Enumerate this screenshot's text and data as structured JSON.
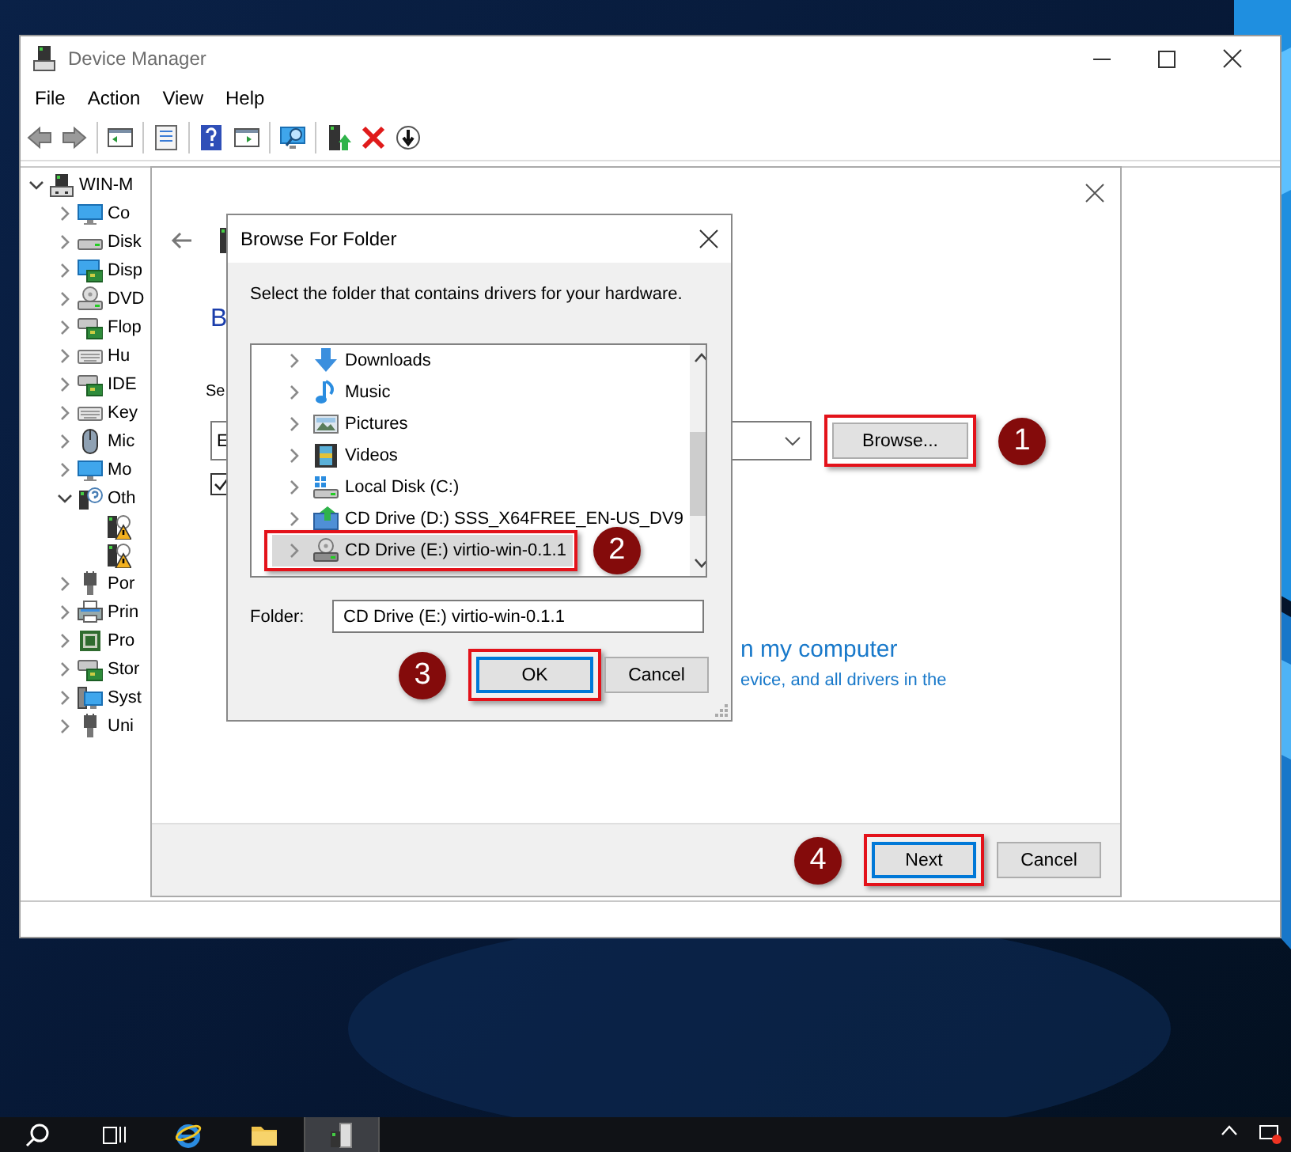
{
  "device_manager": {
    "title": "Device Manager",
    "menu": [
      "File",
      "Action",
      "View",
      "Help"
    ],
    "tree": {
      "label": "WIN-M",
      "expanded": true,
      "children": [
        {
          "label": "Co",
          "expanded": false
        },
        {
          "label": "Disk",
          "expanded": false
        },
        {
          "label": "Disp",
          "expanded": false
        },
        {
          "label": "DVD",
          "expanded": false
        },
        {
          "label": "Flop",
          "expanded": false
        },
        {
          "label": "Hu",
          "expanded": false
        },
        {
          "label": "IDE",
          "expanded": false
        },
        {
          "label": "Key",
          "expanded": false
        },
        {
          "label": "Mic",
          "expanded": false
        },
        {
          "label": "Mo",
          "expanded": false
        },
        {
          "label": "Oth",
          "expanded": true,
          "children": [
            {
              "warning": true
            },
            {
              "warning": true
            }
          ]
        },
        {
          "label": "Por",
          "expanded": false
        },
        {
          "label": "Prin",
          "expanded": false
        },
        {
          "label": "Pro",
          "expanded": false
        },
        {
          "label": "Stor",
          "expanded": false
        },
        {
          "label": "Syst",
          "expanded": false
        },
        {
          "label": "Uni",
          "expanded": false
        }
      ]
    }
  },
  "wizard": {
    "heading": "B",
    "location_label": "Se",
    "location": "E",
    "include_subfolders": true,
    "browse_button": {
      "label": "Browse...",
      "step": "1"
    },
    "option_title": "n my computer",
    "option_text": "evice, and all drivers in the",
    "buttons": [
      {
        "label": "Next",
        "focused": true,
        "step": "4"
      },
      {
        "label": "Cancel",
        "focused": false
      }
    ]
  },
  "browse_dialog": {
    "title": "Browse For Folder",
    "prompt": "Select the folder that contains drivers for your hardware.",
    "folders": [
      {
        "label": "Downloads",
        "selected": false
      },
      {
        "label": "Music",
        "selected": false
      },
      {
        "label": "Pictures",
        "selected": false
      },
      {
        "label": "Videos",
        "selected": false
      },
      {
        "label": "Local Disk (C:)",
        "selected": false
      },
      {
        "label": "CD Drive (D:) SSS_X64FREE_EN-US_DV9",
        "selected": false
      },
      {
        "label": "CD Drive (E:) virtio-win-0.1.1",
        "selected": true,
        "step": "2"
      }
    ],
    "folder_label": "Folder:",
    "folder_value": "CD Drive (E:) virtio-win-0.1.1",
    "buttons": [
      {
        "label": "OK",
        "focused": true,
        "step": "3"
      },
      {
        "label": "Cancel",
        "focused": false
      }
    ]
  },
  "taskbar": {
    "apps": [
      {
        "selected": false
      },
      {
        "selected": false
      },
      {
        "selected": true
      }
    ]
  }
}
